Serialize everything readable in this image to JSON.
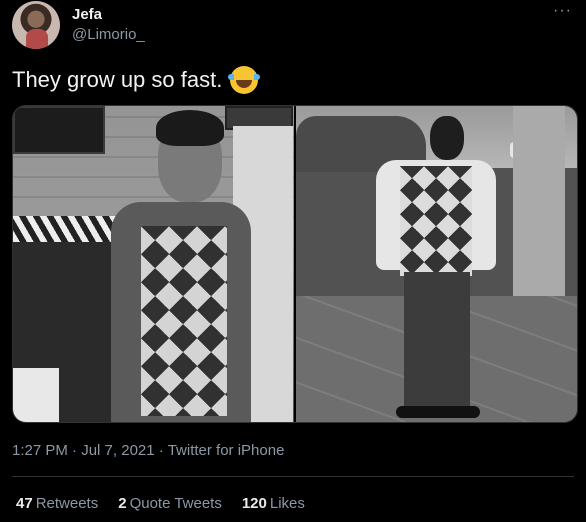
{
  "author": {
    "display_name": "Jefa",
    "handle": "@Limorio_",
    "avatar_icon": "profile-avatar"
  },
  "more_icon": "more-options-icon",
  "tweet": {
    "text": "They grow up so fast.",
    "emoji": "face-with-tears-of-joy"
  },
  "meta": {
    "time": "1:27 PM",
    "sep": "·",
    "date": "Jul 7, 2021",
    "source": "Twitter for iPhone"
  },
  "stats": {
    "retweets": {
      "count": "47",
      "label": "Retweets"
    },
    "quote_tweets": {
      "count": "2",
      "label": "Quote Tweets"
    },
    "likes": {
      "count": "120",
      "label": "Likes"
    }
  }
}
